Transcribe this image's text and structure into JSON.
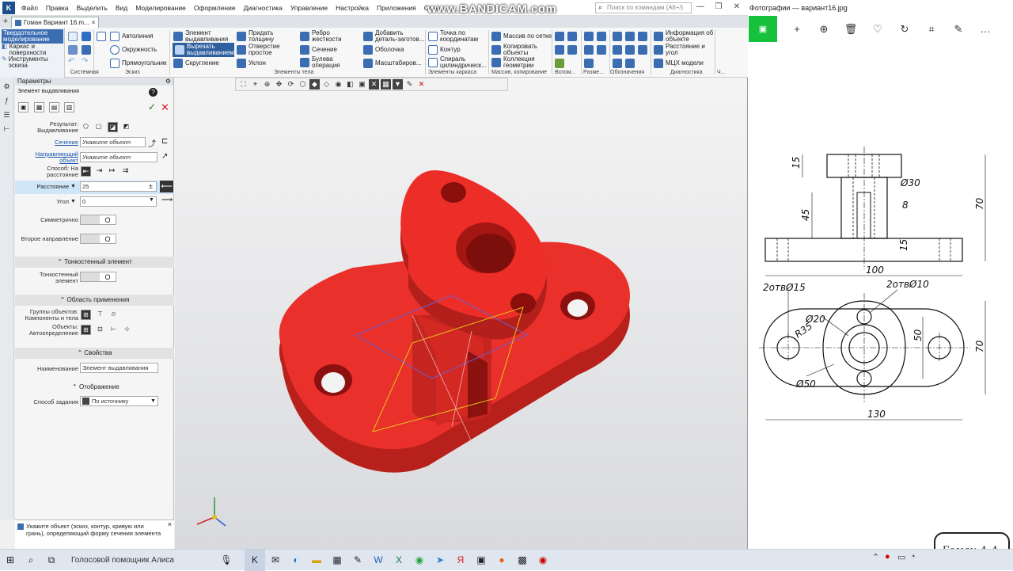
{
  "menu": {
    "items": [
      "Файл",
      "Правка",
      "Выделить",
      "Вид",
      "Моделирование",
      "Оформление",
      "Диагностика",
      "Управление",
      "Настройка",
      "Приложения",
      "Окно"
    ],
    "search_placeholder": "Поиск по командам (Alt+/)",
    "watermark": "www.BANDICAM.com"
  },
  "document_tab": {
    "label": "Гоман Вариант 16.m...",
    "close": "×"
  },
  "ribbon": {
    "modes": [
      {
        "label": "Твердотельное моделирование",
        "active": true
      },
      {
        "label": "Каркас и поверхности",
        "active": false
      },
      {
        "label": "Инструменты эскиза",
        "active": false
      }
    ],
    "buttons": {
      "autoline": "Автолиния",
      "circle": "Окружность",
      "rectangle": "Прямоугольник",
      "extrude": "Элемент выдавливания",
      "cut_extrude": "Вырезать выдавливанием",
      "fillet": "Скругление",
      "thickness": "Придать толщину",
      "hole": "Отверстие простое",
      "chamfer": "Уклон",
      "rib": "Ребро жесткости",
      "section": "Сечение",
      "boolean": "Булева операция",
      "add_part": "Добавить деталь-заготов...",
      "shell": "Оболочка",
      "scale": "Масштабиров...",
      "point_coords": "Точка по координатам",
      "contour": "Контур",
      "spiral": "Спираль цилиндрическ...",
      "grid_array": "Массив по сетке",
      "copy_objects": "Копировать объекты",
      "geometry_collection": "Коллекция геометрии",
      "object_info": "Информация об объекте",
      "distance_angle": "Расстояние и угол",
      "mass_props": "МЦХ модели"
    },
    "group_labels": [
      "Системная",
      "Эскиз",
      "Элементы тела",
      "Элементы каркаса",
      "Массив, копирование",
      "Вспом...",
      "Разме...",
      "Обозначения",
      "Диагностика",
      "Ч..."
    ]
  },
  "params_panel": {
    "title": "Параметры",
    "subtitle": "Элемент выдавливания",
    "result_label": "Результат: Выдавливание",
    "sections_label": "Сечение",
    "sections_placeholder": "Укажите объект",
    "guide_label": "Направляющий объект",
    "guide_placeholder": "Укажите объект",
    "method_label": "Способ: На расстояние",
    "distance_label": "Расстояние",
    "distance_value": "25",
    "angle_label": "Угол",
    "angle_value": "0",
    "symmetric_label": "Симметрично",
    "second_dir_label": "Второе направление",
    "thin_section": "Тонкостенный элемент",
    "thin_label": "Тонкостенный элемент",
    "scope_section": "Область применения",
    "groups_label": "Группы объектов: Компоненты и тела",
    "objects_label": "Объекты: Автоопределение",
    "props_section": "Свойства",
    "name_label": "Наименование",
    "name_value": "Элемент выдавливания",
    "display_section": "Отображение",
    "method2_label": "Способ задания",
    "method2_value": "По источнику",
    "hint": "Укажите объект (эскиз, контур, кривую или грань), определяющий форму сечения элемента"
  },
  "photos": {
    "title": "Фотографии — вариант16.jpg"
  },
  "drawing": {
    "dims": [
      "15",
      "Ø30",
      "8",
      "45",
      "70",
      "100",
      "15",
      "2отвØ15",
      "2отвØ10",
      "Ø20",
      "R35",
      "50",
      "70",
      "Ø50",
      "130"
    ]
  },
  "signature": "Гоман А.А.",
  "taskbar": {
    "search": "Голосовой помощник Алиса"
  },
  "colors": {
    "model": "#ee2a26",
    "model_dark": "#b51612",
    "ribbon_active": "#2f5f9e",
    "photos_accent": "#16c23c"
  }
}
